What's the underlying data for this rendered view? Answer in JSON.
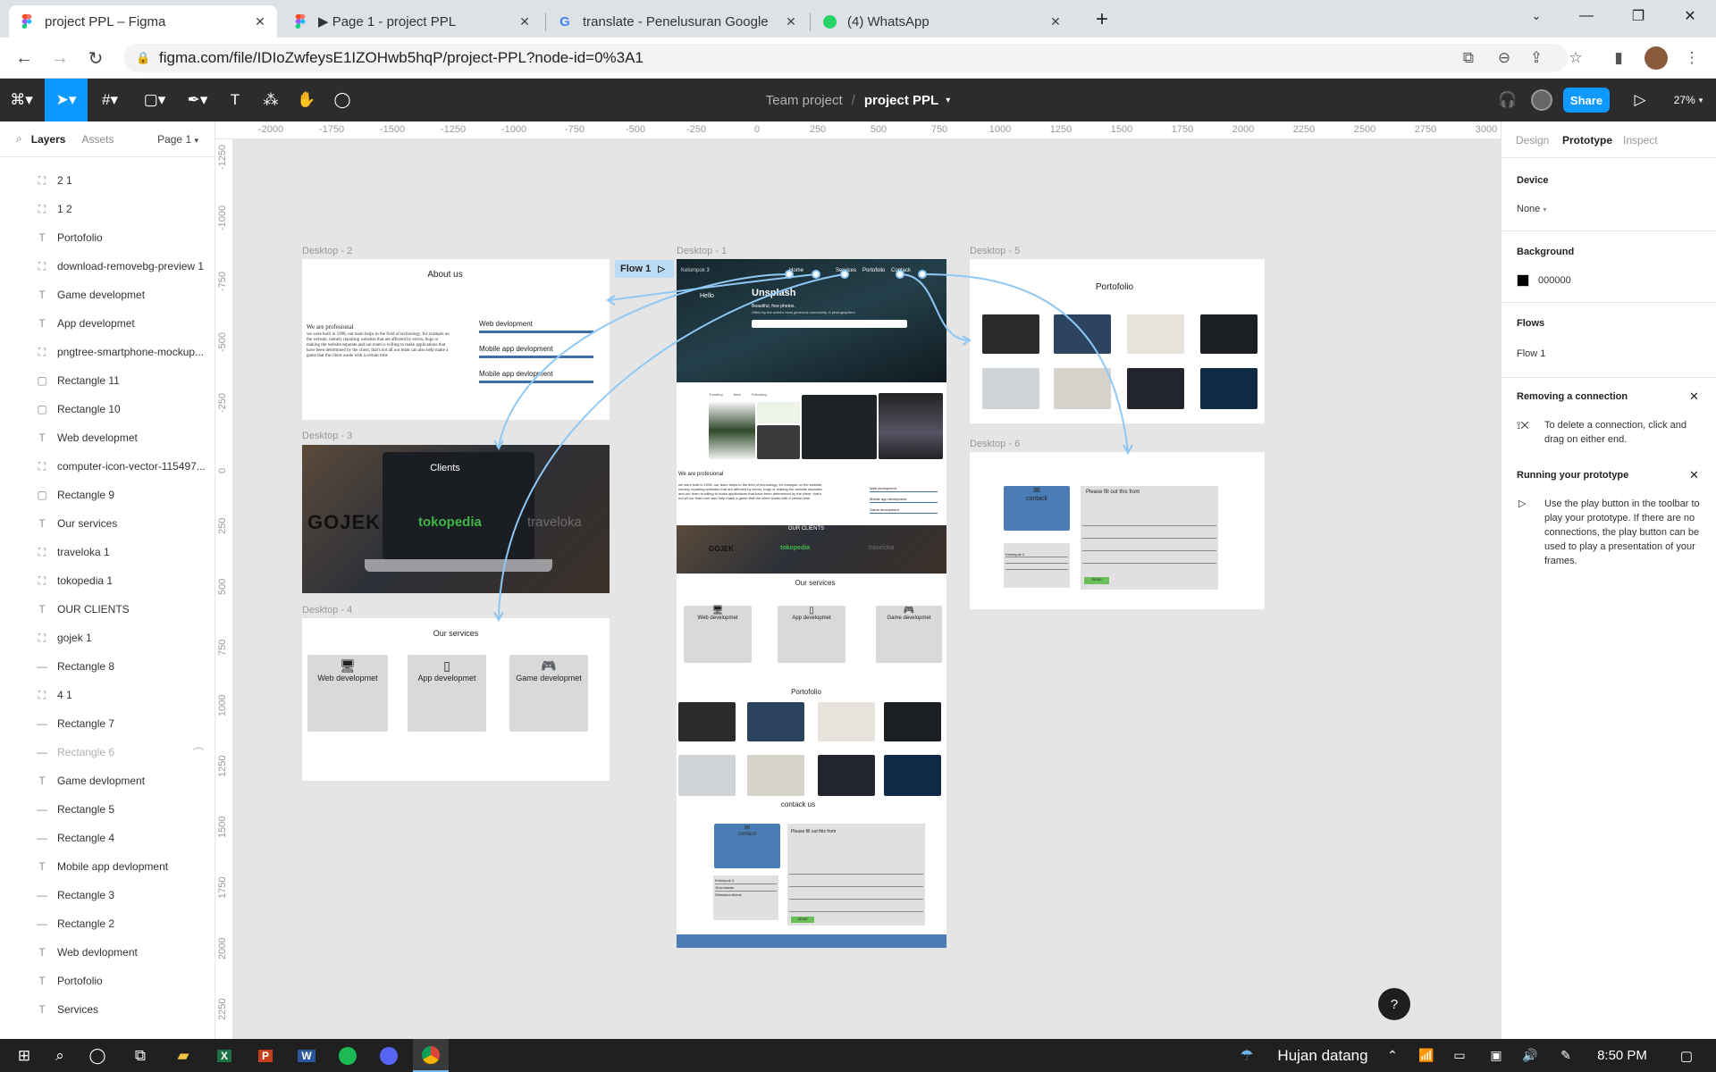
{
  "browser": {
    "tabs": [
      {
        "title": "project PPL – Figma",
        "icon": "figma-icon"
      },
      {
        "title": "▶ Page 1 - project PPL",
        "icon": "figma-icon"
      },
      {
        "title": "translate - Penelusuran Google",
        "icon": "google-icon"
      },
      {
        "title": "(4) WhatsApp",
        "icon": "whatsapp-icon"
      }
    ],
    "url": "figma.com/file/IDIoZwfeysE1IZOHwb5hqP/project-PPL?node-id=0%3A1"
  },
  "figma": {
    "team": "Team project",
    "file": "project PPL",
    "share": "Share",
    "zoom": "27%"
  },
  "left_panel": {
    "tab_layers": "Layers",
    "tab_assets": "Assets",
    "page": "Page 1",
    "layers": [
      {
        "name": "2 1",
        "type": "image"
      },
      {
        "name": "1 2",
        "type": "image"
      },
      {
        "name": "Portofolio",
        "type": "text"
      },
      {
        "name": "download-removebg-preview 1",
        "type": "image"
      },
      {
        "name": "Game developmet",
        "type": "text"
      },
      {
        "name": "App developmet",
        "type": "text"
      },
      {
        "name": "pngtree-smartphone-mockup...",
        "type": "image"
      },
      {
        "name": "Rectangle 11",
        "type": "rect"
      },
      {
        "name": "Rectangle 10",
        "type": "rect"
      },
      {
        "name": "Web developmet",
        "type": "text"
      },
      {
        "name": "computer-icon-vector-115497...",
        "type": "image"
      },
      {
        "name": "Rectangle 9",
        "type": "rect"
      },
      {
        "name": "Our services",
        "type": "text"
      },
      {
        "name": "traveloka 1",
        "type": "image"
      },
      {
        "name": "tokopedia 1",
        "type": "image"
      },
      {
        "name": "OUR CLIENTS",
        "type": "text"
      },
      {
        "name": "gojek 1",
        "type": "image"
      },
      {
        "name": "Rectangle 8",
        "type": "line"
      },
      {
        "name": "4 1",
        "type": "image"
      },
      {
        "name": "Rectangle 7",
        "type": "line"
      },
      {
        "name": "Rectangle 6",
        "type": "line"
      },
      {
        "name": "Game devlopment",
        "type": "text"
      },
      {
        "name": "Rectangle 5",
        "type": "line"
      },
      {
        "name": "Rectangle 4",
        "type": "line"
      },
      {
        "name": "Mobile app devlopment",
        "type": "text"
      },
      {
        "name": "Rectangle 3",
        "type": "line"
      },
      {
        "name": "Rectangle 2",
        "type": "line"
      },
      {
        "name": "Web devlopment",
        "type": "text"
      },
      {
        "name": "Portofolio",
        "type": "text"
      },
      {
        "name": "Services",
        "type": "text"
      }
    ]
  },
  "rulers": {
    "top": [
      "-2000",
      "-1750",
      "-1500",
      "-1250",
      "-1000",
      "-750",
      "-500",
      "-250",
      "0",
      "250",
      "500",
      "750",
      "1000",
      "1250",
      "1500",
      "1750",
      "2000",
      "2250",
      "2500",
      "2750",
      "3000"
    ],
    "left": [
      "-1250",
      "-1000",
      "-750",
      "-500",
      "-250",
      "0",
      "250",
      "500",
      "750",
      "1000",
      "1250",
      "1500",
      "1750",
      "2000",
      "2250"
    ]
  },
  "canvas": {
    "frames": {
      "d1": "Desktop - 1",
      "d2": "Desktop - 2",
      "d3": "Desktop - 3",
      "d4": "Desktop - 4",
      "d5": "Desktop - 5",
      "d6": "Desktop - 6"
    },
    "flow_badge": "Flow 1",
    "d2": {
      "title": "About us",
      "subtitle": "We are profesional",
      "body": "we were built in 1998, our team helps in the field of technology, for example on the website, namely repairing websites that are affected by errors, bugs or making the website separate and our team is willing to make applications that have been determined by the client, that's not all our team can also help make a game that the client wants with a certain time",
      "skills": [
        "Web devlopment",
        "Mobile app devlopment",
        "Mobile app devlopment"
      ]
    },
    "d3": {
      "title": "Clients",
      "clients": [
        "GOJEK",
        "tokopedia",
        "traveloka"
      ]
    },
    "d4": {
      "title": "Our services",
      "services": [
        "Web developmet",
        "App developmet",
        "Game developmet"
      ]
    },
    "d5": {
      "title": "Portofolio"
    },
    "d6": {
      "contact": "contack",
      "form_title": "Please fill out this from",
      "send": "SEND"
    },
    "d1": {
      "brand": "Kelompok 3",
      "nav": [
        "Home",
        "Services",
        "Portofolio",
        "Contack"
      ],
      "hello": "Hello",
      "hero_title": "Unsplash",
      "hero_sub": "Beautiful, free photos.",
      "hero_sub2": "Gifted by the world's most generous community of photographers.",
      "tabs": [
        "Trending",
        "New",
        "Following"
      ],
      "about_title": "We are profesional",
      "about_body": "we were built in 1998, our team helps in the field of technology, for example on the website, namely repairing websites that are affected by errors, bugs or making the website separate and our team is willing to make applications that have been determined by the client, that's not all our team can also help make a game that the client wants with a certain time",
      "skills": [
        "Web devlopment",
        "Mobile app devlopment",
        "Game devlopment"
      ],
      "clients_title": "OUR CLIENTS",
      "services_title": "Our services",
      "services": [
        "Web developmet",
        "App developmet",
        "Game developmet"
      ],
      "portfolio_title": "Portofolio",
      "contact_title": "contack us",
      "contact_box": "contack",
      "form_title": "Please fill out this from",
      "send": "SEND",
      "side_info": [
        "Kelompok 3",
        "1Kurniawan",
        "2Maulana Akmal"
      ]
    }
  },
  "right_panel": {
    "tabs": [
      "Design",
      "Prototype",
      "Inspect"
    ],
    "device_label": "Device",
    "device_value": "None",
    "background_label": "Background",
    "background_hex": "000000",
    "flows_label": "Flows",
    "flow_item": "Flow 1",
    "removing_title": "Removing a connection",
    "removing_text": "To delete a connection, click and drag on either end.",
    "running_title": "Running your prototype",
    "running_text": "Use the play button in the toolbar to play your prototype. If there are no connections, the play button can be used to play a presentation of your frames."
  },
  "taskbar": {
    "weather": "Hujan datang",
    "time": "8:50 PM"
  },
  "colors": {
    "figma_blue": "#0d99ff",
    "flow_line": "#8fc8f5",
    "contact_blue": "#4a7db5",
    "skill_bar": "#3d6fa8",
    "send_green": "#6bbf59"
  }
}
